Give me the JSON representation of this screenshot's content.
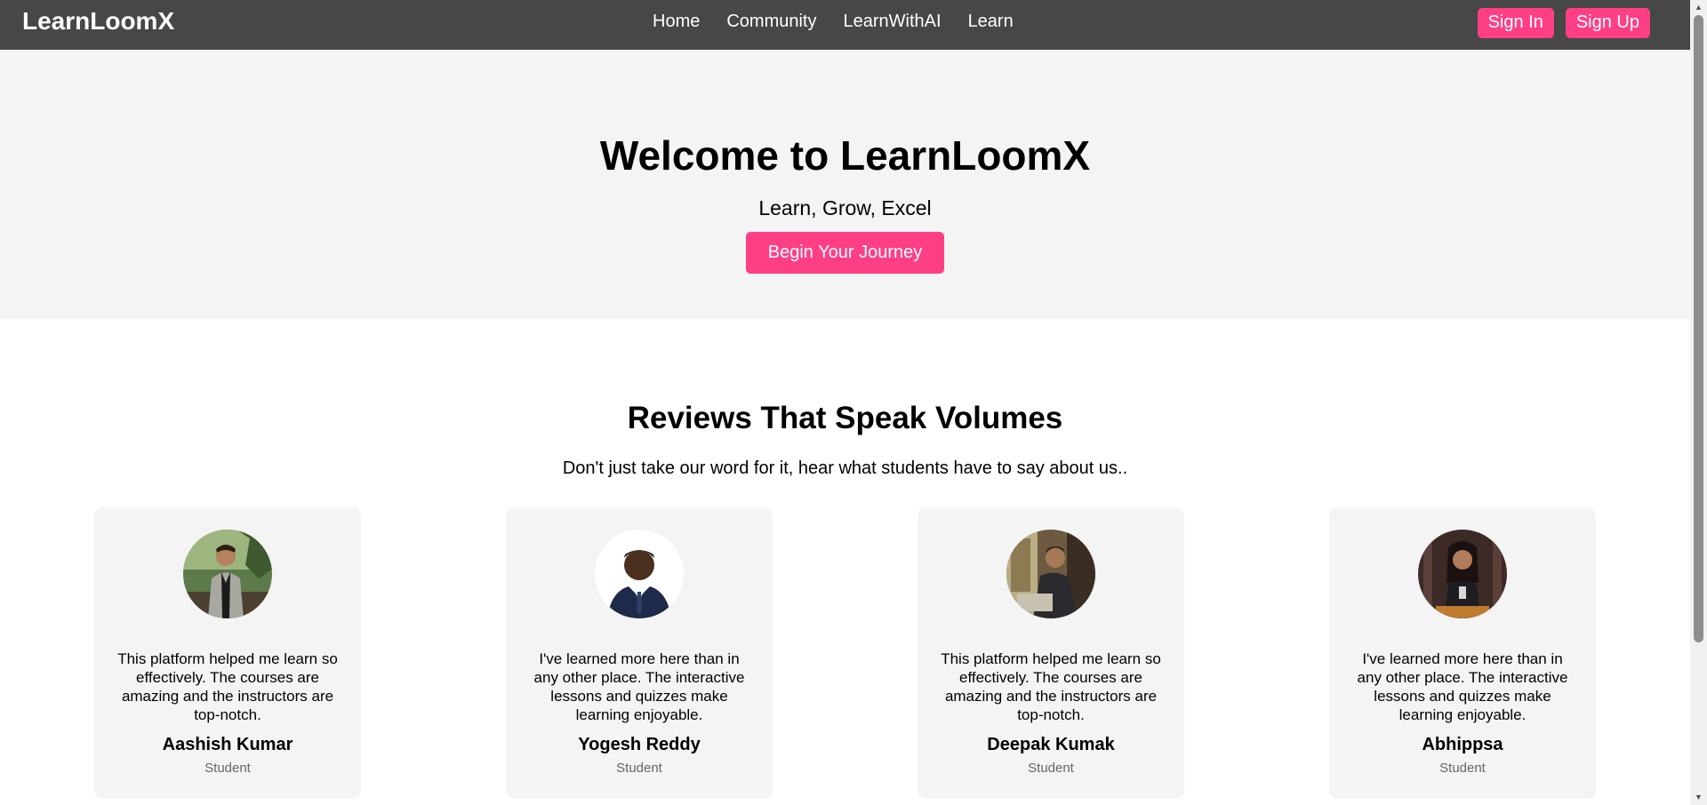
{
  "nav": {
    "brand": "LearnLoomX",
    "links": [
      "Home",
      "Community",
      "LearnWithAI",
      "Learn"
    ],
    "sign_in": "Sign In",
    "sign_up": "Sign Up"
  },
  "hero": {
    "title": "Welcome to LearnLoomX",
    "subtitle": "Learn, Grow, Excel",
    "cta": "Begin Your Journey"
  },
  "reviews": {
    "title": "Reviews That Speak Volumes",
    "subtitle": "Don't just take our word for it, hear what students have to say about us..",
    "items": [
      {
        "quote": "This platform helped me learn so effectively. The courses are amazing and the instructors are top-notch.",
        "name": "Aashish Kumar",
        "role": "Student"
      },
      {
        "quote": "I've learned more here than in any other place. The interactive lessons and quizzes make learning enjoyable.",
        "name": "Yogesh Reddy",
        "role": "Student"
      },
      {
        "quote": "This platform helped me learn so effectively. The courses are amazing and the instructors are top-notch.",
        "name": "Deepak Kumak",
        "role": "Student"
      },
      {
        "quote": "I've learned more here than in any other place. The interactive lessons and quizzes make learning enjoyable.",
        "name": "Abhippsa",
        "role": "Student"
      }
    ]
  },
  "colors": {
    "navbar": "#474747",
    "accent": "#ff3f85",
    "hero_bg": "#f4f4f4",
    "card_bg": "#f4f4f4"
  },
  "icons": {
    "scroll_up": "scroll-up-arrow-icon",
    "scroll_down": "scroll-down-arrow-icon"
  }
}
